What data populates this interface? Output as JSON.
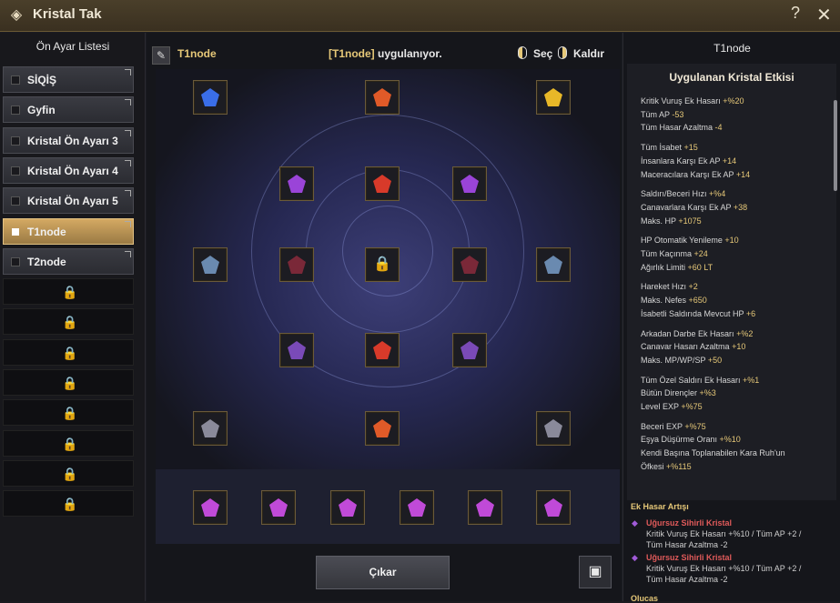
{
  "window": {
    "title": "Kristal Tak",
    "help": "?",
    "close": "✕"
  },
  "left": {
    "header": "Ön Ayar Listesi",
    "presets": [
      {
        "label": "SİQİŞ",
        "active": false,
        "locked": false
      },
      {
        "label": "Gyfin",
        "active": false,
        "locked": false
      },
      {
        "label": "Kristal Ön Ayarı 3",
        "active": false,
        "locked": false
      },
      {
        "label": "Kristal Ön Ayarı 4",
        "active": false,
        "locked": false
      },
      {
        "label": "Kristal Ön Ayarı 5",
        "active": false,
        "locked": false
      },
      {
        "label": "T1node",
        "active": true,
        "locked": false
      },
      {
        "label": "T2node",
        "active": false,
        "locked": false
      },
      {
        "label": "",
        "active": false,
        "locked": true
      },
      {
        "label": "",
        "active": false,
        "locked": true
      },
      {
        "label": "",
        "active": false,
        "locked": true
      },
      {
        "label": "",
        "active": false,
        "locked": true
      },
      {
        "label": "",
        "active": false,
        "locked": true
      },
      {
        "label": "",
        "active": false,
        "locked": true
      },
      {
        "label": "",
        "active": false,
        "locked": true
      },
      {
        "label": "",
        "active": false,
        "locked": true
      }
    ]
  },
  "center": {
    "preset_name": "T1node",
    "status_prefix": "[T1node]",
    "status_suffix": " uygulanıyor.",
    "select_label": "Seç",
    "remove_label": "Kaldır",
    "remove_button": "Çıkar"
  },
  "right": {
    "title": "T1node",
    "panel_title": "Uygulanan Kristal Etkisi",
    "effects": [
      [
        "Kritik Vuruş Ek Hasarı",
        "+%20"
      ],
      [
        "Tüm AP",
        "-53"
      ],
      [
        "Tüm Hasar Azaltma",
        "-4"
      ],
      [
        "Tüm İsabet",
        "+15"
      ],
      [
        "İnsanlara Karşı Ek AP",
        "+14"
      ],
      [
        "Maceracılara Karşı Ek AP",
        "+14"
      ],
      [
        "Saldırı/Beceri Hızı",
        "+%4"
      ],
      [
        "Canavarlara Karşı Ek AP",
        "+38"
      ],
      [
        "Maks. HP",
        "+1075"
      ],
      [
        "HP Otomatik Yenileme",
        "+10"
      ],
      [
        "Tüm Kaçınma",
        "+24"
      ],
      [
        "Ağırlık Limiti",
        "+60 LT"
      ],
      [
        "Hareket Hızı",
        "+2"
      ],
      [
        "Maks. Nefes",
        "+650"
      ],
      [
        "İsabetli Saldırıda Mevcut HP",
        "+6"
      ],
      [
        "Arkadan Darbe Ek Hasarı",
        "+%2"
      ],
      [
        "Canavar Hasarı Azaltma",
        "+10"
      ],
      [
        "Maks. MP/WP/SP",
        "+50"
      ],
      [
        "Tüm Özel Saldırı Ek Hasarı",
        "+%1"
      ],
      [
        "Bütün Dirençler",
        "+%3"
      ],
      [
        "Level EXP",
        "+%75"
      ],
      [
        "Beceri EXP",
        "+%75"
      ],
      [
        "Eşya Düşürme Oranı",
        "+%10"
      ],
      [
        "Kendi Başına Toplanabilen Kara Ruh'un",
        ""
      ],
      [
        "Öfkesi",
        "+%115"
      ]
    ],
    "bonus_header": "Ek Hasar Artışı",
    "bonuses": [
      {
        "name": "Uğursuz Sihirli Kristal",
        "line1": "Kritik Vuruş Ek Hasarı +%10 / Tüm AP +2 /",
        "line2": "Tüm Hasar Azaltma -2"
      },
      {
        "name": "Uğursuz Sihirli Kristal",
        "line1": "Kritik Vuruş Ek Hasarı +%10 / Tüm AP +2 /",
        "line2": "Tüm Hasar Azaltma -2"
      }
    ],
    "footer_header": "Olucas"
  },
  "colors": {
    "accent": "#e6c878",
    "active_preset": "#d4a963",
    "bonus_name": "#e05a5a"
  }
}
